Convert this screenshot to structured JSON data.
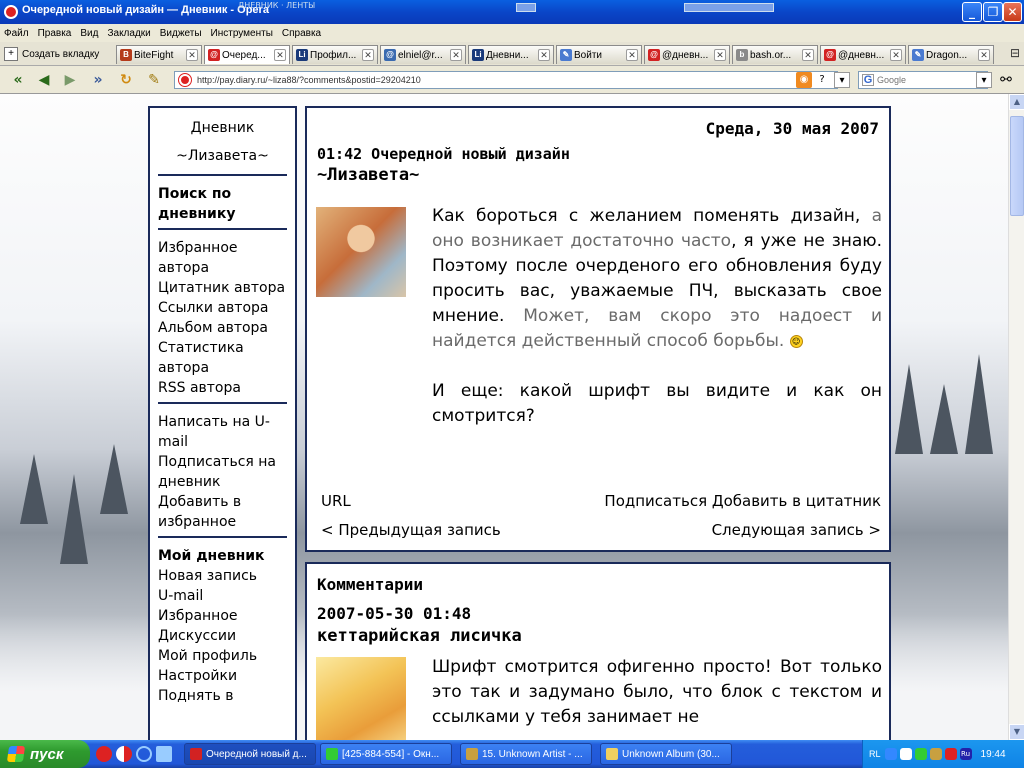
{
  "window": {
    "title": "Очередной новый дизайн — Дневник - Opera",
    "status": "ДНЕВНИК · ЛЕНТЫ"
  },
  "menu": [
    "Файл",
    "Правка",
    "Вид",
    "Закладки",
    "Виджеты",
    "Инструменты",
    "Справка"
  ],
  "tabs": {
    "new_tab_label": "Создать вкладку",
    "items": [
      {
        "label": "BiteFight",
        "icon_color": "#b43a1a",
        "icon_glyph": "B"
      },
      {
        "label": "Очеред...",
        "icon_color": "#d22222",
        "icon_glyph": "@",
        "active": true
      },
      {
        "label": "Профил...",
        "icon_color": "#1a3a7a",
        "icon_glyph": "Li"
      },
      {
        "label": "elniel@r...",
        "icon_color": "#3a6ab0",
        "icon_glyph": "@"
      },
      {
        "label": "Дневни...",
        "icon_color": "#1a3a7a",
        "icon_glyph": "Li"
      },
      {
        "label": "Войти",
        "icon_color": "#4a7ad0",
        "icon_glyph": "✎"
      },
      {
        "label": "@дневн...",
        "icon_color": "#d22222",
        "icon_glyph": "@"
      },
      {
        "label": "bash.or...",
        "icon_color": "#8a8a8a",
        "icon_glyph": "b"
      },
      {
        "label": "@дневн...",
        "icon_color": "#d22222",
        "icon_glyph": "@"
      },
      {
        "label": "Dragon...",
        "icon_color": "#4a7ad0",
        "icon_glyph": "✎"
      }
    ]
  },
  "address": {
    "url": "http://pay.diary.ru/~liza88/?comments&postid=29204210",
    "search_placeholder": "Google",
    "search_engine": "G"
  },
  "sidebar": {
    "blog_label": "Дневник",
    "blog_owner": "~Лизавета~",
    "search_heading": "Поиск по дневнику",
    "author_links": [
      "Избранное автора",
      "Цитатник автора",
      "Ссылки автора",
      "Альбом автора",
      "Статистика автора",
      "RSS автора"
    ],
    "action_links": [
      "Написать на U-mail",
      "Подписаться на дневник",
      "Добавить в избранное"
    ],
    "my_diary_heading": "Мой дневник",
    "my_links": [
      "Новая запись",
      "U-mail",
      "Избранное",
      "Дискуссии",
      "Мой профиль",
      "Настройки",
      "Поднять в"
    ]
  },
  "post": {
    "date": "Среда, 30 мая 2007",
    "time_title": "01:42 Очередной новый дизайн",
    "author": "~Лизавета~",
    "body_1a": "Как бороться с желанием поменять дизайн, ",
    "body_1b_muted": "а оно возникает достаточно часто",
    "body_1c": ", я уже не знаю. Поэтому после очерденого его обновления буду просить вас, уважаемые ПЧ, высказать свое мнение. ",
    "body_1d_muted": "Может, вам скоро это надоест и найдется действенный способ борьбы.",
    "smiley": "☺",
    "body_2": "И еще: какой шрифт вы видите и как он смотрится?",
    "url_label": "URL",
    "subscribe_label": "Подписаться",
    "quote_label": "Добавить в цитатник",
    "prev_label": "< Предыдущая запись",
    "next_label": "Следующая запись >"
  },
  "comments": {
    "heading": "Комментарии",
    "items": [
      {
        "datetime": "2007-05-30 01:48",
        "author": "кеттарийская лисичка",
        "text": "Шрифт смотрится офигенно просто! Вот только это так и задумано было, что блок с текстом и ссылками у тебя занимает не"
      }
    ]
  },
  "taskbar": {
    "start_label": "пуск",
    "items": [
      {
        "label": "Очередной новый д...",
        "icon_color": "#d22222",
        "active": true
      },
      {
        "label": "[425-884-554] - Окн...",
        "icon_color": "#3c3"
      },
      {
        "label": "15. Unknown Artist - ...",
        "icon_color": "#c8a040"
      },
      {
        "label": "Unknown Album (30...",
        "icon_color": "#f0d060"
      }
    ],
    "tray_lang": "RL",
    "clock": "19:44"
  },
  "colors": {
    "panel_border": "#1a2a5a",
    "xp_blue": "#245edb",
    "start_green": "#2e9a2e"
  }
}
